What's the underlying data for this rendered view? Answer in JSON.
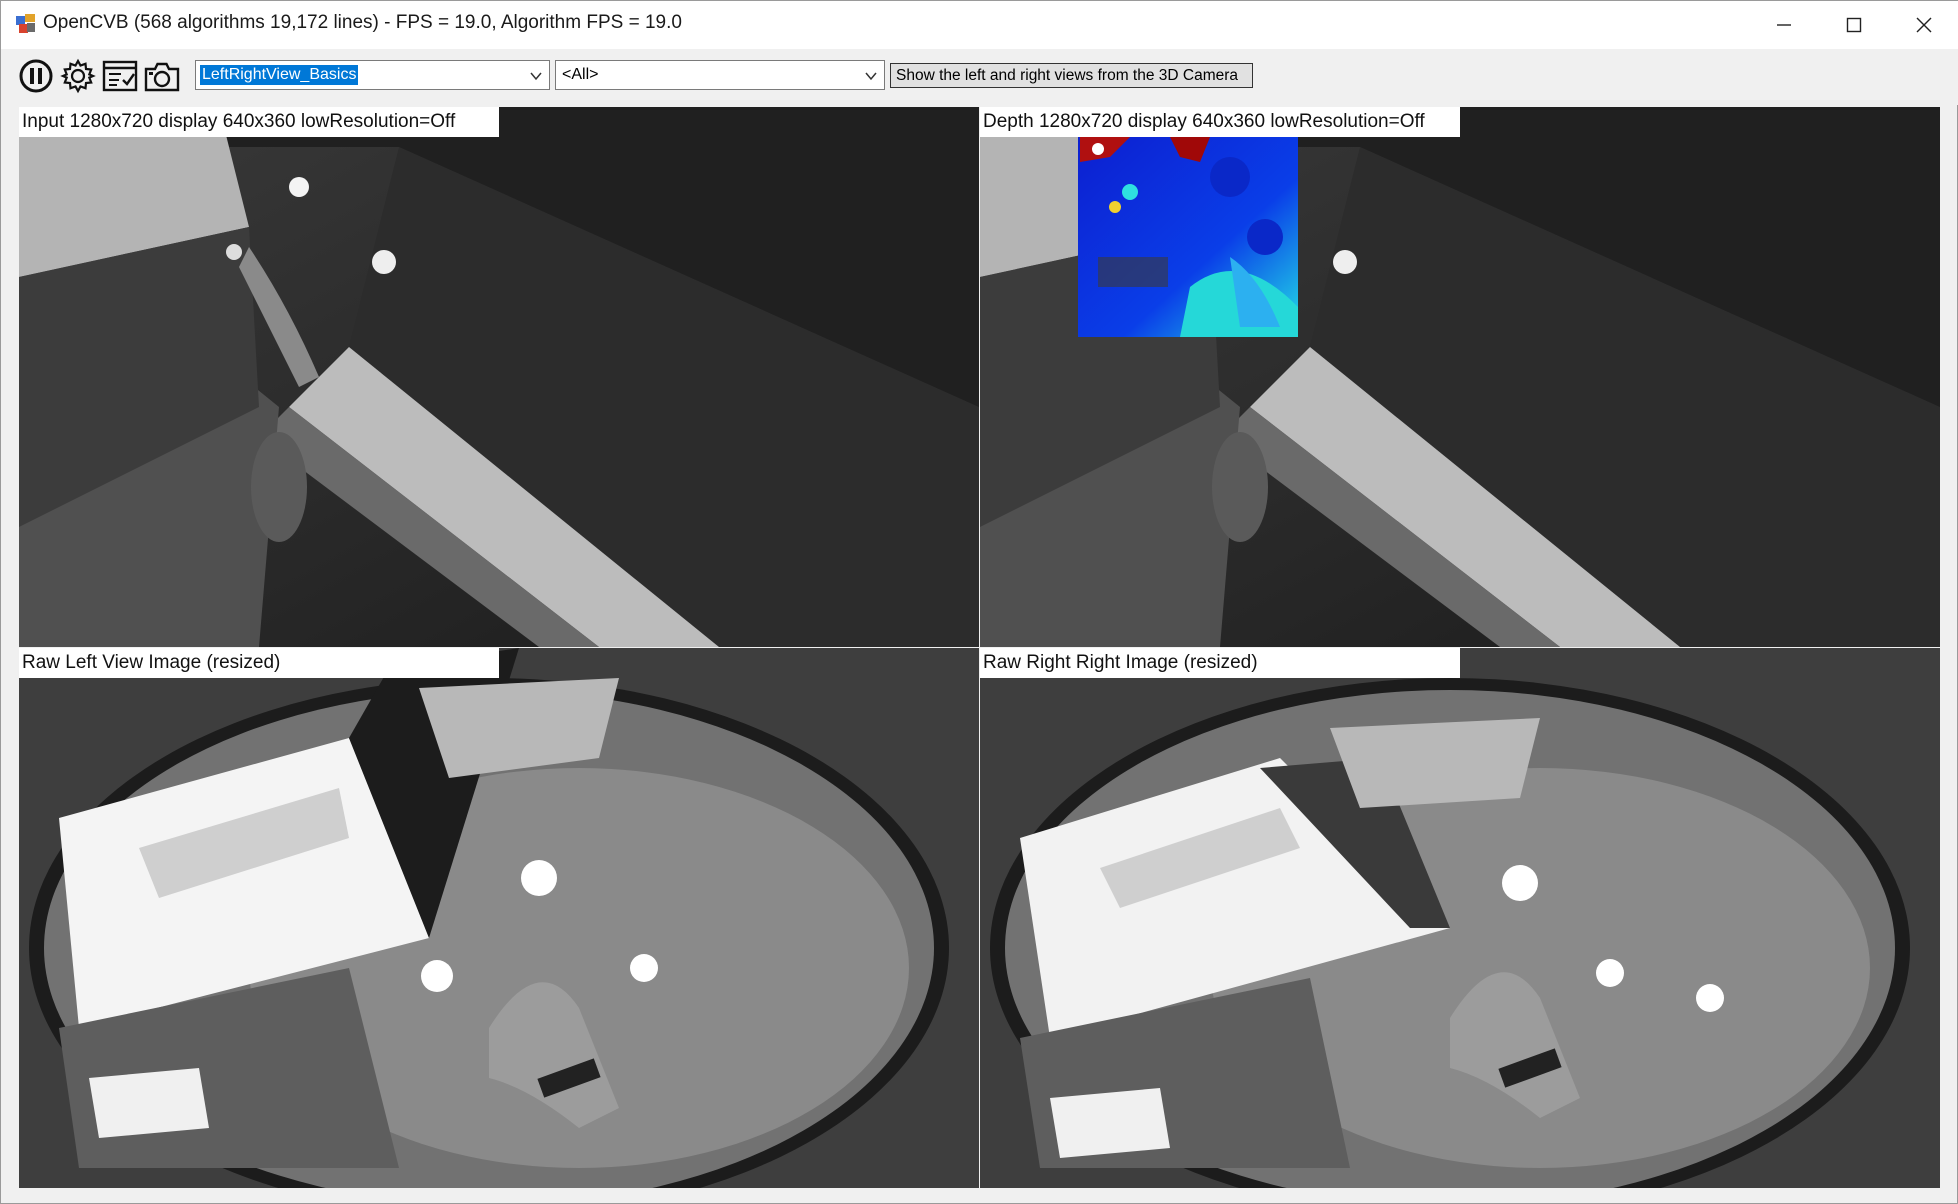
{
  "window": {
    "title": "OpenCVB (568 algorithms 19,172 lines) -  FPS = 19.0, Algorithm FPS = 19.0"
  },
  "toolbar": {
    "icons": [
      "pause-icon",
      "gear-icon",
      "checklist-icon",
      "camera-icon"
    ],
    "algorithm_combo": {
      "value": "LeftRightView_Basics"
    },
    "group_combo": {
      "value": "<All>"
    },
    "description": "Show the left and right views from the 3D Camera"
  },
  "views": {
    "top_left": {
      "label": "Input  1280x720  display  640x360  lowResolution=Off"
    },
    "top_right": {
      "label": "Depth  1280x720  display  640x360  lowResolution=Off"
    },
    "bottom_left": {
      "label": "Raw Left View Image (resized)"
    },
    "bottom_right": {
      "label": "Raw Right Right Image (resized)"
    }
  },
  "colors": {
    "selection": "#0078d7",
    "window_bg": "#f0f0f0"
  }
}
